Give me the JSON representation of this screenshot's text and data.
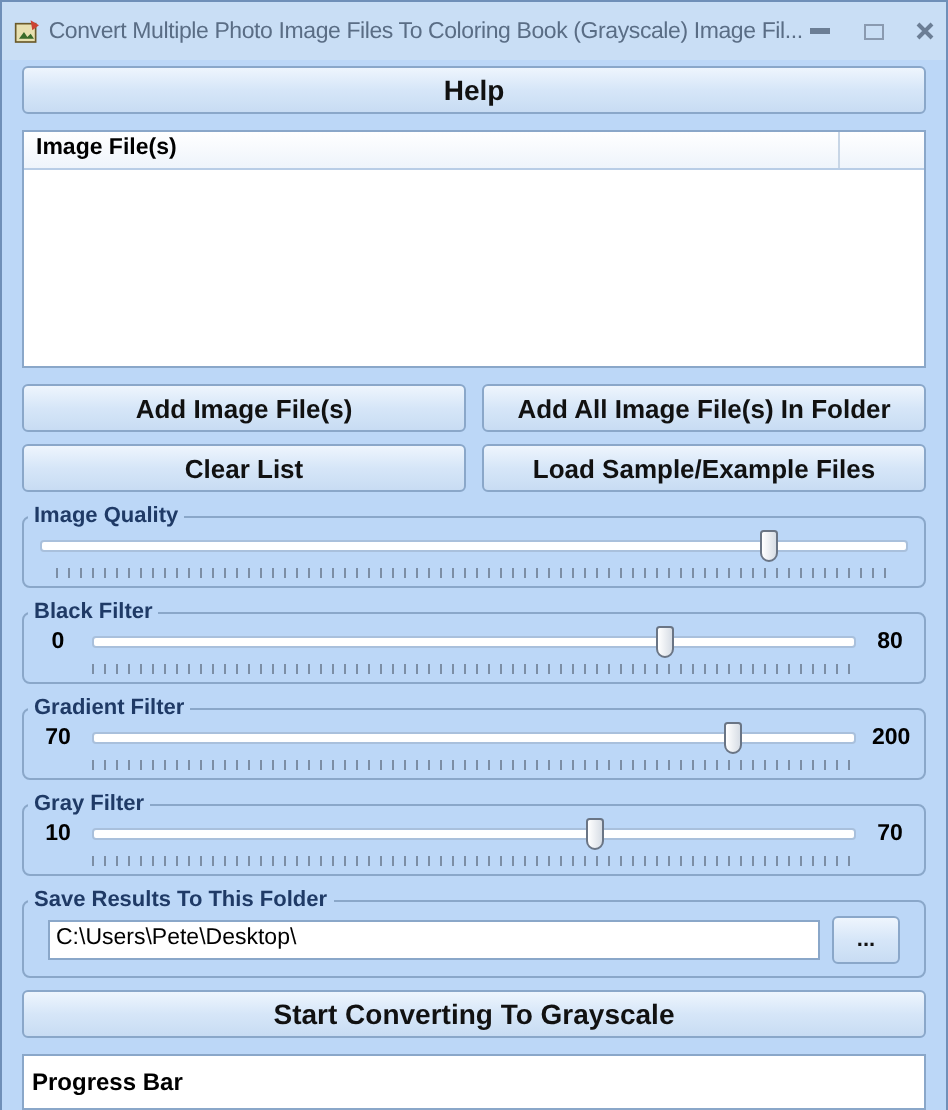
{
  "window": {
    "title": "Convert Multiple Photo Image Files To Coloring Book (Grayscale) Image Fil..."
  },
  "help_button": "Help",
  "file_list": {
    "columns": [
      "Image File(s)"
    ]
  },
  "buttons": [
    "Add Image File(s)",
    "Add All Image File(s) In Folder",
    "Clear List",
    "Load Sample/Example Files"
  ],
  "sliders": [
    {
      "title": "Image Quality",
      "level": 0.84
    },
    {
      "title": "Black Filter",
      "min": "0",
      "max": "80",
      "level": 0.75
    },
    {
      "title": "Gradient Filter",
      "min": "70",
      "max": "200",
      "level": 0.84
    },
    {
      "title": "Gray Filter",
      "min": "10",
      "max": "70",
      "level": 0.66
    }
  ],
  "save_folder": {
    "title": "Save Results To This Folder",
    "value": "C:\\Users\\Pete\\Desktop\\",
    "browse_button": "..."
  },
  "start_button": "Start Converting To Grayscale",
  "progress": {
    "label": "Progress Bar",
    "level": 0
  }
}
